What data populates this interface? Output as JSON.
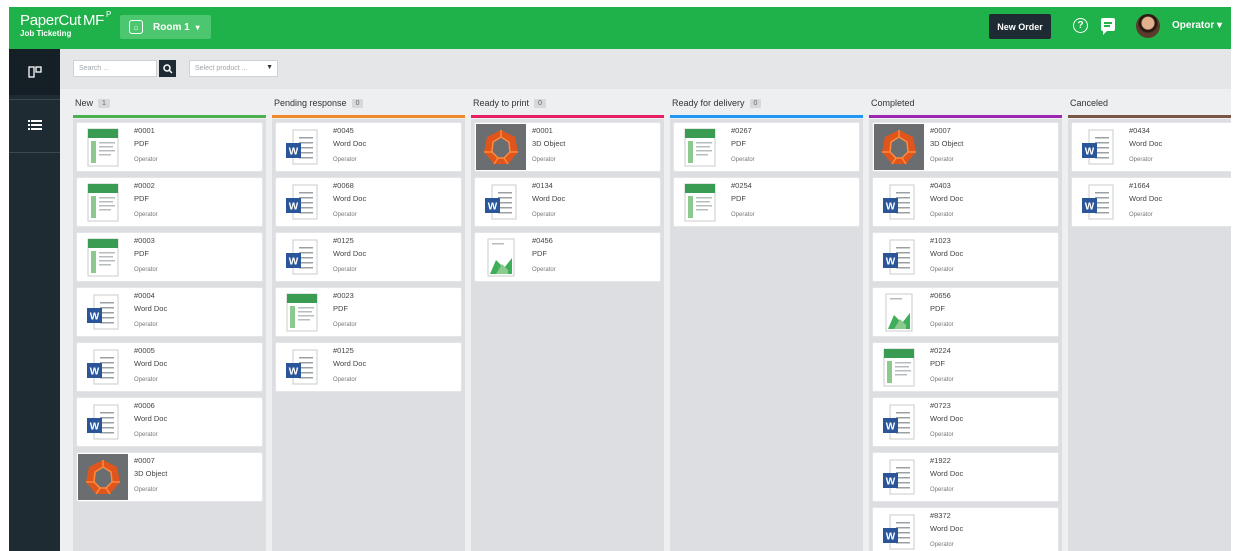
{
  "app": {
    "brand": "PaperCut",
    "brand_suffix": "MF",
    "brand_sup": "P",
    "subtitle": "Job Ticketing",
    "room": "Room 1",
    "new_order": "New Order",
    "help": "?",
    "user": "Operator"
  },
  "toolbar": {
    "search_placeholder": "Search ...",
    "product_placeholder": "Select product ..."
  },
  "colors": {
    "topbar": "#20b24a",
    "sidenav": "#1e2b33"
  },
  "columns": [
    {
      "title": "New",
      "count": "1",
      "color": "#4caf50",
      "cards": [
        {
          "id": "#0001",
          "type": "PDF",
          "user": "Operator",
          "icon": "pdf"
        },
        {
          "id": "#0002",
          "type": "PDF",
          "user": "Operator",
          "icon": "pdf"
        },
        {
          "id": "#0003",
          "type": "PDF",
          "user": "Operator",
          "icon": "pdf"
        },
        {
          "id": "#0004",
          "type": "Word Doc",
          "user": "Operator",
          "icon": "word"
        },
        {
          "id": "#0005",
          "type": "Word Doc",
          "user": "Operator",
          "icon": "word"
        },
        {
          "id": "#0006",
          "type": "Word Doc",
          "user": "Operator",
          "icon": "word"
        },
        {
          "id": "#0007",
          "type": "3D Object",
          "user": "Operator",
          "icon": "3d"
        }
      ]
    },
    {
      "title": "Pending response",
      "count": "0",
      "color": "#f0892c",
      "cards": [
        {
          "id": "#0045",
          "type": "Word Doc",
          "user": "Operator",
          "icon": "word"
        },
        {
          "id": "#0068",
          "type": "Word Doc",
          "user": "Operator",
          "icon": "word"
        },
        {
          "id": "#0125",
          "type": "Word Doc",
          "user": "Operator",
          "icon": "word"
        },
        {
          "id": "#0023",
          "type": "PDF",
          "user": "Operator",
          "icon": "pdf"
        },
        {
          "id": "#0125",
          "type": "Word Doc",
          "user": "Operator",
          "icon": "word"
        }
      ]
    },
    {
      "title": "Ready to print",
      "count": "0",
      "color": "#e91e63",
      "cards": [
        {
          "id": "#0001",
          "type": "3D Object",
          "user": "Operator",
          "icon": "3d"
        },
        {
          "id": "#0134",
          "type": "Word Doc",
          "user": "Operator",
          "icon": "word"
        },
        {
          "id": "#0456",
          "type": "PDF",
          "user": "Operator",
          "icon": "pdf-chart"
        }
      ]
    },
    {
      "title": "Ready for delivery",
      "count": "0",
      "color": "#2196f3",
      "cards": [
        {
          "id": "#0267",
          "type": "PDF",
          "user": "Operator",
          "icon": "pdf"
        },
        {
          "id": "#0254",
          "type": "PDF",
          "user": "Operator",
          "icon": "pdf"
        }
      ]
    },
    {
      "title": "Completed",
      "count": "",
      "color": "#9c27b0",
      "cards": [
        {
          "id": "#0007",
          "type": "3D Object",
          "user": "Operator",
          "icon": "3d"
        },
        {
          "id": "#0403",
          "type": "Word Doc",
          "user": "Operator",
          "icon": "word"
        },
        {
          "id": "#1023",
          "type": "Word Doc",
          "user": "Operator",
          "icon": "word"
        },
        {
          "id": "#0656",
          "type": "PDF",
          "user": "Operator",
          "icon": "pdf-chart"
        },
        {
          "id": "#0224",
          "type": "PDF",
          "user": "Operator",
          "icon": "pdf"
        },
        {
          "id": "#0723",
          "type": "Word Doc",
          "user": "Operator",
          "icon": "word"
        },
        {
          "id": "#1922",
          "type": "Word Doc",
          "user": "Operator",
          "icon": "word"
        },
        {
          "id": "#8372",
          "type": "Word Doc",
          "user": "Operator",
          "icon": "word"
        }
      ]
    },
    {
      "title": "Canceled",
      "count": "",
      "color": "#795548",
      "cards": [
        {
          "id": "#0434",
          "type": "Word Doc",
          "user": "Operator",
          "icon": "word"
        },
        {
          "id": "#1664",
          "type": "Word Doc",
          "user": "Operator",
          "icon": "word"
        }
      ]
    }
  ]
}
